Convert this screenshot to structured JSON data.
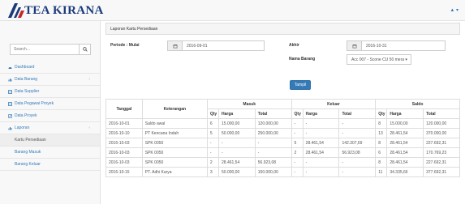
{
  "brand": {
    "name": "TEA KIRANA"
  },
  "user_menu": {
    "label": "▲ ▾"
  },
  "sidebar": {
    "search_placeholder": "Search...",
    "items": [
      {
        "label": "Dashboard",
        "icon": "dashboard-icon"
      },
      {
        "label": "Data Barang",
        "icon": "bar-chart-icon",
        "chevron": "›"
      },
      {
        "label": "Data Supplier",
        "icon": "table-icon"
      },
      {
        "label": "Data Pegawai Proyek",
        "icon": "table-icon"
      },
      {
        "label": "Data Proyek",
        "icon": "edit-icon"
      },
      {
        "label": "Laporan",
        "icon": "bar-chart-icon",
        "chevron": "‹"
      }
    ],
    "sub_items": [
      {
        "label": "Kartu Persediaan",
        "active": true
      },
      {
        "label": "Barang Masuk"
      },
      {
        "label": "Barang Keluar"
      }
    ]
  },
  "panel": {
    "title": "Laporan Kartu Persediaan"
  },
  "form": {
    "periode_label": "Periode : Mulai",
    "mulai_value": "2016-09-01",
    "akhir_label": "Akhir",
    "akhir_value": "2016-10-31",
    "nama_barang_label": "Nama Barang",
    "nama_barang_value": "Acc 007 - Scone CU 50 mera ▾",
    "tampil_label": "Tampil"
  },
  "table": {
    "headers": {
      "tanggal": "Tanggal",
      "keterangan": "Keterangan",
      "masuk": "Masuk",
      "keluar": "Keluar",
      "saldo": "Saldo",
      "qty": "Qty",
      "harga": "Harga",
      "total": "Total"
    },
    "rows": [
      [
        "2016-10-01",
        "Saldo awal",
        "6",
        "15.000,00",
        "120.000,00",
        "-",
        "-",
        "-",
        "8",
        "15.000,00",
        "120.000,00"
      ],
      [
        "2016-10-10",
        "PT Kencana Indah",
        "5",
        "50.000,00",
        "250.000,00",
        "-",
        "-",
        "-",
        "13",
        "28.461,54",
        "370.000,00"
      ],
      [
        "2016-10-03",
        "SPK 0050",
        "-",
        "-",
        "-",
        "5",
        "28.461,54",
        "142.307,69",
        "8",
        "28.461,54",
        "227.692,31"
      ],
      [
        "2016-10-03",
        "SPK 0050",
        "-",
        "-",
        "-",
        "2",
        "28.461,54",
        "56.923,08",
        "6",
        "28.461,54",
        "170.769,23"
      ],
      [
        "2016-10-03",
        "SPK 0050",
        "2",
        "28.461,54",
        "56.923,08",
        "-",
        "-",
        "-",
        "8",
        "28.461,54",
        "227.692,31"
      ],
      [
        "2016-10-15",
        "PT. Adhi Karya",
        "3",
        "50.000,00",
        "150.000,00",
        "-",
        "-",
        "-",
        "11",
        "34.335,66",
        "377.692,31"
      ]
    ]
  }
}
